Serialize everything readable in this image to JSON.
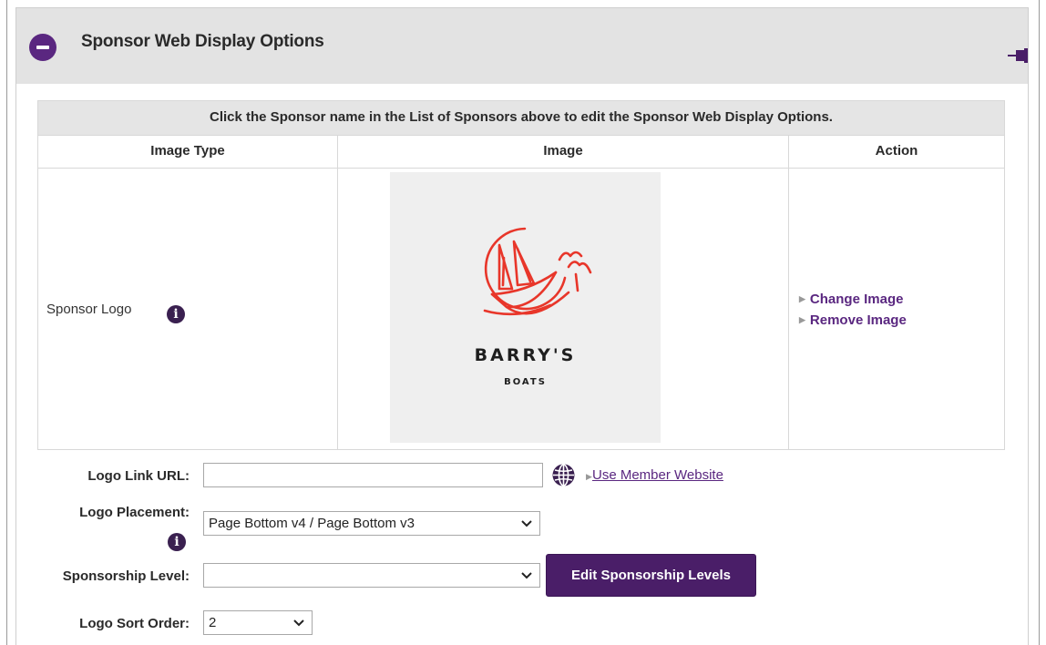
{
  "panel": {
    "title": "Sponsor Web Display Options"
  },
  "table": {
    "notice": "Click the Sponsor name in the List of Sponsors above to edit the Sponsor Web Display Options.",
    "headers": [
      "Image Type",
      "Image",
      "Action"
    ],
    "row": {
      "image_type": "Sponsor Logo",
      "logo": {
        "title": "BARRY'S",
        "subtitle": "BOATS"
      },
      "actions": [
        "Change Image",
        "Remove Image"
      ]
    }
  },
  "form": {
    "logo_link_url": {
      "label": "Logo Link URL:",
      "value": "",
      "helper_link": "Use Member Website"
    },
    "logo_placement": {
      "label": "Logo Placement:",
      "selected": "Page Bottom v4 / Page Bottom v3"
    },
    "sponsorship_level": {
      "label": "Sponsorship Level:",
      "selected": "",
      "button": "Edit Sponsorship Levels"
    },
    "logo_sort_order": {
      "label": "Logo Sort Order:",
      "selected": "2"
    }
  },
  "icons": {
    "collapse": "minus-circle-icon",
    "pin": "pin-icon",
    "info": "info-icon",
    "globe": "globe-icon",
    "dropdown": "chevron-down-icon"
  },
  "colors": {
    "accent": "#5a2780",
    "button": "#4a1e68",
    "logo_red": "#e8362a",
    "header_bg": "#e3e3e3"
  }
}
